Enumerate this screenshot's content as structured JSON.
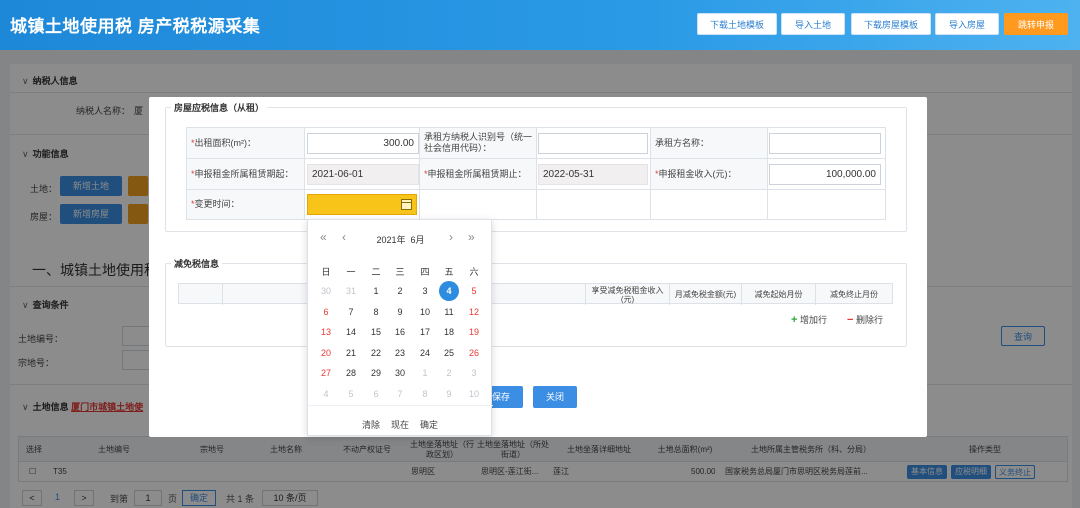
{
  "header": {
    "title": "城镇土地使用税 房产税税源采集",
    "buttons": [
      "下载土地模板",
      "导入土地",
      "下载房屋模板",
      "导入房屋",
      "跳转申报"
    ]
  },
  "page": {
    "taxpayer_section": "纳税人信息",
    "taxpayer_label": "纳税人名称：",
    "taxpayer_value": "厦",
    "function_section": "功能信息",
    "land_label": "土地：",
    "add_land": "新增土地",
    "house_label": "房屋：",
    "add_house": "新增房屋",
    "big_title": "一、城镇土地使用税",
    "query_section": "查询条件",
    "land_no_label": "土地编号：",
    "parcel_label": "宗地号：",
    "query_button": "查询",
    "land_info_section": "土地信息",
    "land_info_link": "厦门市城镇土地使",
    "land_table": {
      "headers": [
        "选择",
        "土地编号",
        "宗地号",
        "土地名称",
        "不动产权证号",
        "土地坐落地址（行政区划）",
        "土地坐落地址（所处街道）",
        "土地坐落详细地址",
        "土地总面积(m²)",
        "土地所属主管税务所（科、分局）",
        "操作类型"
      ],
      "row": {
        "land_no": "T35",
        "district": "思明区",
        "street": "思明区-莲江街...",
        "address": "莲江",
        "area": "500.00",
        "tax_office": "国家税务总局厦门市思明区税务局莲前...",
        "actions": [
          "基本信息",
          "应税明细",
          "义务终止"
        ]
      }
    },
    "pager": {
      "prev": "<",
      "page": "1",
      "next": ">",
      "goto": "到第",
      "goto_page": "1",
      "page_unit": "页",
      "confirm": "确定",
      "total": "共 1 条",
      "size": "10 条/页"
    }
  },
  "modal": {
    "section_title": "房屋应税信息（从租）",
    "fields": {
      "rent_area_label": "出租面积(m²)：",
      "rent_area_value": "300.00",
      "lessee_id_label": "承租方纳税人识别号（统一社会信用代码）：",
      "lessee_id_value": "",
      "lessee_name_label": "承租方名称：",
      "lessee_name_value": "",
      "rent_start_label": "申报租金所属租赁期起：",
      "rent_start_value": "2021-06-01",
      "rent_end_label": "申报租金所属租赁期止：",
      "rent_end_value": "2022-05-31",
      "rent_income_label": "申报租金收入(元)：",
      "rent_income_value": "100,000.00",
      "change_time_label": "变更时间：",
      "change_time_value": ""
    },
    "relief_title": "减免税信息",
    "relief_headers": [
      "享受减免税租金收入(元)",
      "月减免税金额(元)",
      "减免起始月份",
      "减免终止月份"
    ],
    "add_row": "增加行",
    "delete_row": "删除行",
    "save": "保存",
    "close": "关闭"
  },
  "datepicker": {
    "nav": {
      "prev_year": "«",
      "prev_month": "‹",
      "next_month": "›",
      "next_year": "»"
    },
    "year": "2021年",
    "month": "6月",
    "weekdays": [
      "日",
      "一",
      "二",
      "三",
      "四",
      "五",
      "六"
    ],
    "days": [
      [
        "30",
        "31",
        "1",
        "2",
        "3",
        "4",
        "5"
      ],
      [
        "6",
        "7",
        "8",
        "9",
        "10",
        "11",
        "12"
      ],
      [
        "13",
        "14",
        "15",
        "16",
        "17",
        "18",
        "19"
      ],
      [
        "20",
        "21",
        "22",
        "23",
        "24",
        "25",
        "26"
      ],
      [
        "27",
        "28",
        "29",
        "30",
        "1",
        "2",
        "3"
      ],
      [
        "4",
        "5",
        "6",
        "7",
        "8",
        "9",
        "10"
      ]
    ],
    "today": "4",
    "footer": [
      "清除",
      "现在",
      "确定"
    ]
  },
  "colors": {
    "header_blue": "#1e88d8",
    "accent_orange": "#ff9a1f",
    "button_blue": "#3b8ee4",
    "active_yellow": "#f9c41a",
    "weekend_red": "#e53935"
  }
}
